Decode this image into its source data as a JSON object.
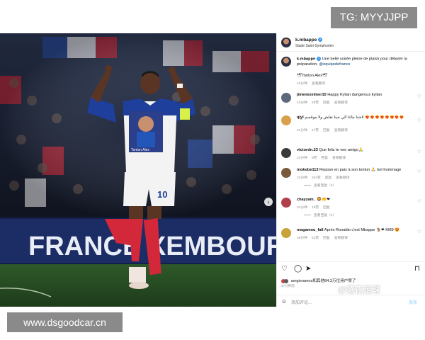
{
  "watermarks": {
    "top_right": "TG: MYYJJPP",
    "bottom_left": "www.dsgoodcar.cn",
    "overlay": "@落夜足球"
  },
  "photo": {
    "banner_text": "FRANCE     XEMBOURG",
    "shirt_number": "10",
    "shirt_caption": "Tonton Alex"
  },
  "post": {
    "author": "k.mbappe",
    "location": "Stade Saint-Symphorien",
    "caption_user": "k.mbappe",
    "caption_text": "Une belle soirée pleine de plaisir pour débuter la préparation. ",
    "caption_mention": "@equipedefrance",
    "caption_line2": "🕊Tonton Alex🕊",
    "caption_time": "43分钟",
    "caption_translate": "查看翻译"
  },
  "comments": [
    {
      "user": "jimenezelmer10",
      "text": "Happy Kylian dangerous kylian",
      "time": "43分钟",
      "likes": "28赞",
      "reply": "回复",
      "translate": "查看翻译",
      "avatar_color": "#5a6a7a",
      "replies": ""
    },
    {
      "user": "ql̲y̲l",
      "text": "لاشنا مالنا الي جينا نقلش ولا موقسم ❤‍🔥❤‍🔥❤‍🔥❤‍🔥❤‍🔥❤‍🔥❤‍🔥❤‍🔥",
      "time": "21分钟",
      "likes": "17赞",
      "reply": "回复",
      "translate": "查看翻译",
      "avatar_color": "#d9a24a",
      "replies": ""
    },
    {
      "user": "victordn.23",
      "text": "Que feliz te veo amigo🙏",
      "time": "23分钟",
      "likes": "9赞",
      "reply": "回复",
      "translate": "查看翻译",
      "avatar_color": "#3a3a3a",
      "replies": ""
    },
    {
      "user": "mokobe113",
      "text": "Repose en paix à son tonton 🙏 bel hommage",
      "time": "23分钟",
      "likes": "204赞",
      "reply": "回复",
      "translate": "查看翻译",
      "avatar_color": "#7a5a3a",
      "replies": "查看回复（2）"
    },
    {
      "user": "chayzam_",
      "text": "🦁🤲❤",
      "time": "34分钟",
      "likes": "15赞",
      "reply": "回复",
      "translate": "",
      "avatar_color": "#b0404a",
      "replies": "查看回复（1）"
    },
    {
      "user": "magamou_fall",
      "text": "Après Ronaldo c'est Mbappe 🐐❤ KM9 😍",
      "time": "38分钟",
      "likes": "51赞",
      "reply": "回复",
      "translate": "查看翻译",
      "avatar_color": "#c9a23a",
      "replies": ""
    }
  ],
  "actions": {
    "likes_text": "sergioramos和其他84.3万位用户赞了",
    "date": "47分钟前",
    "comment_placeholder": "添加评论...",
    "post_label": "发布"
  }
}
